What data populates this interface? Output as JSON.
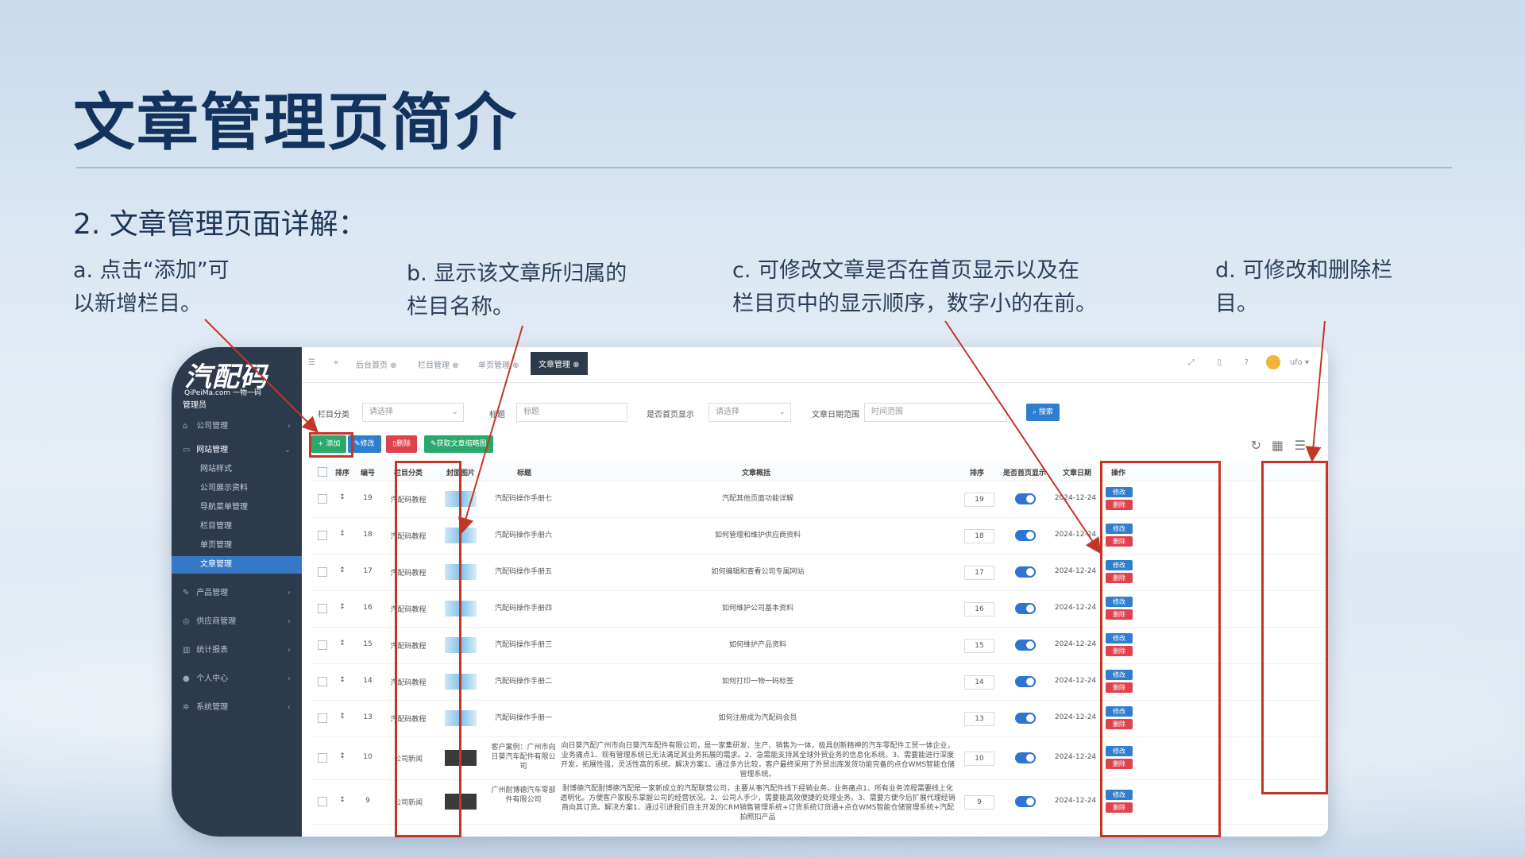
{
  "slide": {
    "title": "文章管理页简介",
    "subtitle": "2. 文章管理页面详解：",
    "notes": {
      "a_line1": "a. 点击“添加”可",
      "a_line2": "以新增栏目。",
      "b_line1": "b. 显示该文章所归属的",
      "b_line2": "栏目名称。",
      "c_line1": "c. 可修改文章是否在首页显示以及在",
      "c_line2": "栏目页中的显示顺序，数字小的在前。",
      "d_line1": "d. 可修改和删除栏",
      "d_line2": "目。"
    },
    "annotation_color": "#c23628"
  },
  "app": {
    "logo": "汽配码",
    "logo_sub": "QiPeiMa.com 一物一码",
    "role": "管理员",
    "sidebar": {
      "groups": [
        {
          "label": "公司管理",
          "icon": "bank-icon"
        },
        {
          "label": "网站管理",
          "icon": "monitor-icon"
        },
        {
          "label": "产品管理",
          "icon": "wrench-icon"
        },
        {
          "label": "供应商管理",
          "icon": "globe-icon"
        },
        {
          "label": "统计报表",
          "icon": "chart-icon"
        },
        {
          "label": "个人中心",
          "icon": "user-icon"
        },
        {
          "label": "系统管理",
          "icon": "gears-icon"
        }
      ],
      "subitems": [
        "网站样式",
        "公司展示资料",
        "导航菜单管理",
        "栏目管理",
        "单页管理",
        "文章管理"
      ],
      "active": "文章管理"
    },
    "tabs": [
      "后台首页",
      "栏目管理",
      "单页管理",
      "文章管理"
    ],
    "active_tab": "文章管理",
    "user": "ufo",
    "search": {
      "category_label": "栏目分类",
      "category_value": "请选择",
      "title_label": "标题",
      "title_placeholder": "标题",
      "home_label": "是否首页显示",
      "home_value": "请选择",
      "date_label": "文章日期范围",
      "date_placeholder": "时间范围",
      "search_btn": "搜索"
    },
    "toolbar": {
      "add": "+ 添加",
      "edit": "修改",
      "delete": "删除",
      "fetch": "获取文章缩略图"
    },
    "columns": [
      "排序",
      "编号",
      "栏目分类",
      "封面图片",
      "标题",
      "文章概括",
      "排序",
      "是否首页显示",
      "文章日期",
      "操作"
    ],
    "row_actions": {
      "edit": "修改",
      "delete": "删除"
    },
    "rows": [
      {
        "id": "19",
        "category": "汽配码教程",
        "title": "汽配码操作手册七",
        "summary": "汽配其他页面功能详解",
        "sort": "19",
        "date": "2024-12-24"
      },
      {
        "id": "18",
        "category": "汽配码教程",
        "title": "汽配码操作手册六",
        "summary": "如何管理和维护供应商资料",
        "sort": "18",
        "date": "2024-12-24"
      },
      {
        "id": "17",
        "category": "汽配码教程",
        "title": "汽配码操作手册五",
        "summary": "如何编辑和查看公司专属网站",
        "sort": "17",
        "date": "2024-12-24"
      },
      {
        "id": "16",
        "category": "汽配码教程",
        "title": "汽配码操作手册四",
        "summary": "如何维护公司基本资料",
        "sort": "16",
        "date": "2024-12-24"
      },
      {
        "id": "15",
        "category": "汽配码教程",
        "title": "汽配码操作手册三",
        "summary": "如何维护产品资料",
        "sort": "15",
        "date": "2024-12-24"
      },
      {
        "id": "14",
        "category": "汽配码教程",
        "title": "汽配码操作手册二",
        "summary": "如何打印一物一码标签",
        "sort": "14",
        "date": "2024-12-24"
      },
      {
        "id": "13",
        "category": "汽配码教程",
        "title": "汽配码操作手册一",
        "summary": "如何注册成为汽配码会员",
        "sort": "13",
        "date": "2024-12-24"
      },
      {
        "id": "10",
        "category": "公司新闻",
        "title": "客户案例：广州市向日葵汽车配件有限公司",
        "summary": "向日葵汽配广州市向日葵汽车配件有限公司，是一家集研发、生产、销售为一体，极具创新精神的汽车零配件工贸一体企业，业务痛点1、现有管理系统已无法满足其业务拓展的需求。2、急需能支持其全球外贸业务的信息化系统。3、需要能进行深度开发，拓展性强，灵活性高的系统。解决方案1、通过多方比较，客户最终采用了外贸出库发货功能完备的点仓WMS智能仓储管理系统。",
        "sort": "10",
        "date": "2024-12-24"
      },
      {
        "id": "9",
        "category": "公司新闻",
        "title": "广州耐博德汽车零部件有限公司",
        "summary": "耐博德汽配耐博德汽配是一家新成立的汽配联营公司，主要从事汽配件线下经销业务。业务痛点1、所有业务流程需要线上化透明化。方便客户家股东掌握公司的经营状况。2、公司人手少，需要能高效便捷的处理业务。3、需要方便今后扩展代理经销商向其订货。解决方案1、通过引进我们自主开发的CRM销售管理系统+订货系统订货通+点仓WMS智能仓储管理系统+汽配拍照扣产品",
        "sort": "9",
        "date": "2024-12-24"
      }
    ]
  }
}
